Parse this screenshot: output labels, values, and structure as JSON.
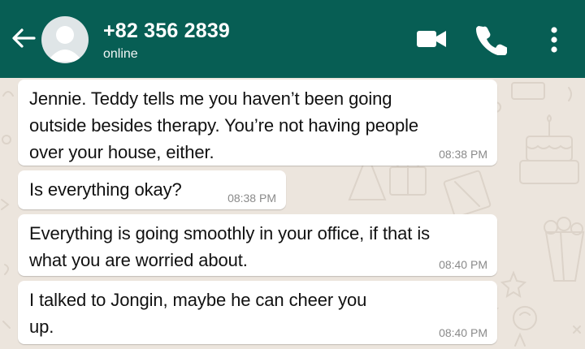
{
  "header": {
    "contact": "+82 356 2839",
    "status": "online",
    "icons": [
      "back-arrow-icon",
      "avatar-placeholder-icon",
      "video-call-icon",
      "phone-icon",
      "more-vert-icon"
    ],
    "bg_color": "#075E54"
  },
  "messages": [
    {
      "text": "Jennie. Teddy tells me you haven’t been going\noutside besides therapy. You’re not having people\nover your house, either.",
      "time": "08:38 PM"
    },
    {
      "text": "Is everything okay?",
      "time": "08:38 PM"
    },
    {
      "text": "Everything is going smoothly in your office, if that is\nwhat you are worried about.",
      "time": "08:40 PM"
    },
    {
      "text": "I talked to Jongin, maybe he can cheer you\nup.",
      "time": "08:40 PM"
    }
  ]
}
